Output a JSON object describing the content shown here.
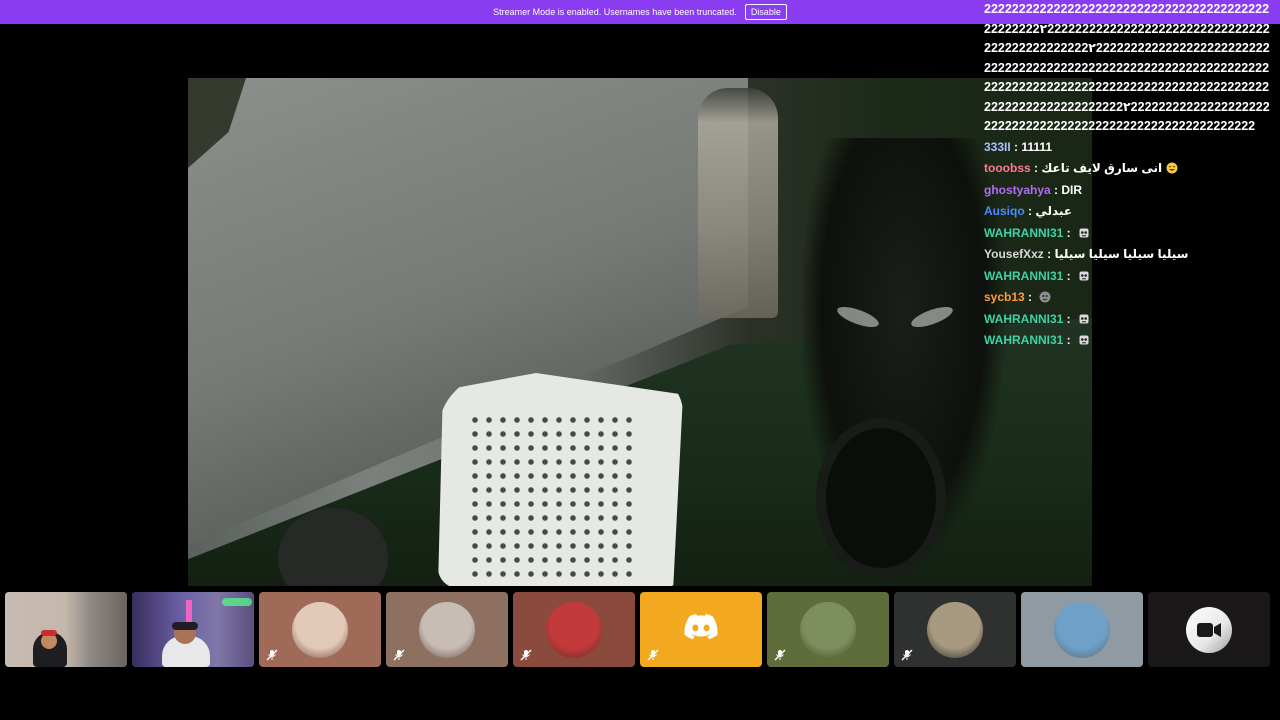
{
  "banner": {
    "message": "Streamer Mode is enabled. Usernames have been truncated.",
    "disable_label": "Disable"
  },
  "chat": {
    "spam": "2222222222222222222222222222222222222222222222222۲22222222222222222222222222222222222222222222222۲2222222222222222222222222222222222222222222222222222222222222222222222222222222222222222222222222222222222222222222222222222222۲22222222222222222222222222222222222222222222222222222222222",
    "messages": [
      {
        "user": "333II",
        "color": "#a8c0ff",
        "text": "11111",
        "emote": ""
      },
      {
        "user": "tooobss",
        "color": "#ff7a93",
        "text": "انى سارق لايف تاعك",
        "emote": "laughing-emoji"
      },
      {
        "user": "ghostyahya",
        "color": "#b26cf5",
        "text": "DIR",
        "emote": ""
      },
      {
        "user": "Ausiqo",
        "color": "#4a8cff",
        "text": "عبدلي",
        "emote": ""
      },
      {
        "user": "WAHRANNI31",
        "color": "#3fd2a8",
        "text": "",
        "emote": "skull-emote"
      },
      {
        "user": "YousefXxz",
        "color": "#d8d8d8",
        "text": "سيليا سيليا سيليا سيليا",
        "emote": ""
      },
      {
        "user": "WAHRANNI31",
        "color": "#3fd2a8",
        "text": "",
        "emote": "skull-emote"
      },
      {
        "user": "sycb13",
        "color": "#ff9b3d",
        "text": "",
        "emote": "face-emote"
      },
      {
        "user": "WAHRANNI31",
        "color": "#3fd2a8",
        "text": "",
        "emote": "skull-emote"
      },
      {
        "user": "WAHRANNI31",
        "color": "#3fd2a8",
        "text": "",
        "emote": "skull-emote"
      }
    ]
  },
  "tiles": [
    {
      "name": "participant-camera-1",
      "kind": "camera",
      "bg": "#b9aca2"
    },
    {
      "name": "participant-camera-2",
      "kind": "camera",
      "bg": "#564f7c"
    },
    {
      "name": "participant-avatar-3",
      "kind": "avatar",
      "bg": "#a06a58",
      "avatar": "#e3c9b7",
      "muted": true
    },
    {
      "name": "participant-avatar-4",
      "kind": "avatar",
      "bg": "#8e7060",
      "avatar": "#c8bdb5",
      "muted": true
    },
    {
      "name": "participant-avatar-5",
      "kind": "avatar",
      "bg": "#8a4a3e",
      "avatar": "#c23a3a",
      "muted": true
    },
    {
      "name": "participant-discord-6",
      "kind": "discord",
      "bg": "#f2a81f",
      "muted": true
    },
    {
      "name": "participant-avatar-7",
      "kind": "avatar",
      "bg": "#5f6d3a",
      "avatar": "#7e8f5e",
      "muted": true
    },
    {
      "name": "participant-avatar-8",
      "kind": "avatar",
      "bg": "#2f3131",
      "avatar": "#a89a80",
      "muted": true
    },
    {
      "name": "participant-avatar-9",
      "kind": "avatar",
      "bg": "#8f9aa3",
      "avatar": "#6fa0c8",
      "muted": false
    },
    {
      "name": "camera-toggle-tile",
      "kind": "camera-toggle",
      "bg": "#1a1818"
    }
  ]
}
